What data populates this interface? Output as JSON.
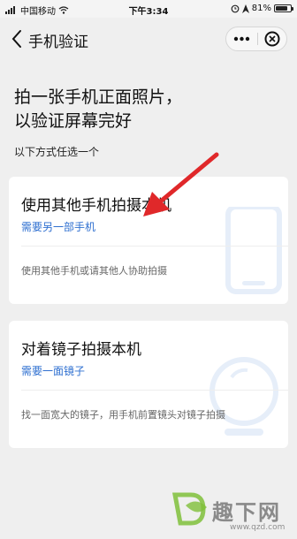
{
  "status_bar": {
    "carrier": "中国移动",
    "time": "下午3:34",
    "battery": "81%",
    "battery_level": 0.81
  },
  "nav": {
    "title": "手机验证",
    "back_icon": "chevron-left-icon",
    "more_icon": "more-dots-icon",
    "close_icon": "close-circle-icon"
  },
  "page": {
    "headline_line1": "拍一张手机正面照片，",
    "headline_line2": "以验证屏幕完好",
    "subhead": "以下方式任选一个"
  },
  "options": [
    {
      "title": "使用其他手机拍摄本机",
      "link": "需要另一部手机",
      "desc": "使用其他手机或请其他人协助拍摄",
      "icon": "phone-outline-icon"
    },
    {
      "title": "对着镜子拍摄本机",
      "link": "需要一面镜子",
      "desc": "找一面宽大的镜子，用手机前置镜头对镜子拍摄",
      "icon": "mirror-outline-icon"
    }
  ],
  "watermark": {
    "text": "趣下网",
    "url": "www.qzd.com"
  },
  "colors": {
    "link": "#2e6fd0",
    "arrow": "#e0282a",
    "illustration": "#e6eef9",
    "background": "#efefef"
  }
}
